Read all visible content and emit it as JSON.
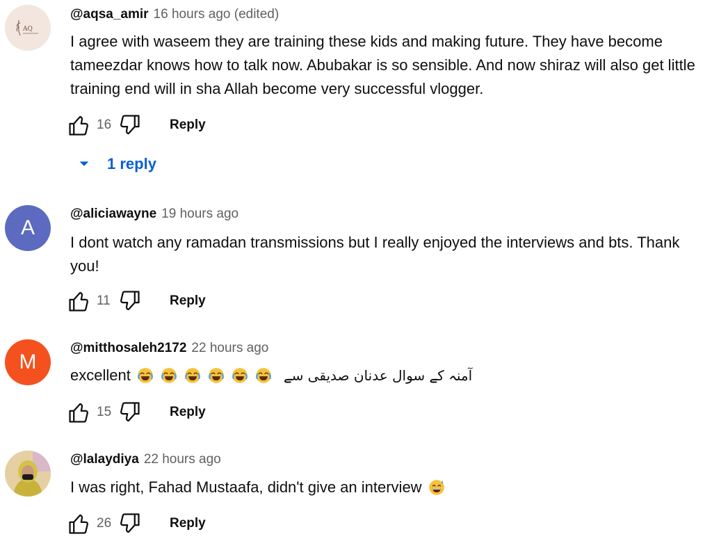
{
  "comments": [
    {
      "author": "@aqsa_amir",
      "time": "16 hours ago (edited)",
      "text": "I agree with waseem they are training these kids and making future. They have become tameezdar knows how to talk now. Abubakar is so sensible. And now shiraz will also get little training end will  in sha Allah become very successful vlogger.",
      "likes": "16",
      "reply_label": "Reply",
      "replies_label": "1 reply",
      "avatar_text": "AQ",
      "avatar_color": "#f2e6df"
    },
    {
      "author": "@aliciawayne",
      "time": "19 hours ago",
      "text": "I dont watch any ramadan transmissions but I really enjoyed the interviews and bts. Thank you!",
      "likes": "11",
      "reply_label": "Reply",
      "avatar_text": "A",
      "avatar_color": "#5c6bc0"
    },
    {
      "author": "@mitthosaleh2172",
      "time": "22 hours ago",
      "text": "excellent",
      "text_urdu": "آمنہ کے سوال عدنان صدیقی سے",
      "likes": "15",
      "reply_label": "Reply",
      "avatar_text": "M",
      "avatar_color": "#f4511e"
    },
    {
      "author": "@lalaydiya",
      "time": "22 hours ago",
      "text": "I was right, Fahad Mustaafa, didn't give an interview",
      "likes": "26",
      "reply_label": "Reply",
      "avatar_color": "#e8d9b0"
    }
  ],
  "icons": {
    "like": "thumbs-up-icon",
    "dislike": "thumbs-down-icon",
    "replies_toggle": "caret-down-icon",
    "laugh_emoji": "face-with-tears-of-joy",
    "sweat_emoji": "grinning-face-with-sweat"
  },
  "colors": {
    "link_blue": "#065fd4",
    "muted": "#606060",
    "text": "#0f0f0f"
  }
}
